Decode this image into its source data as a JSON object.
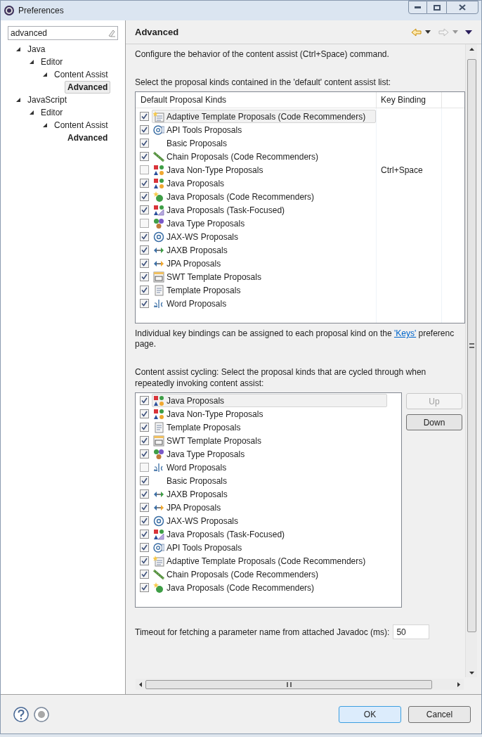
{
  "window": {
    "title": "Preferences"
  },
  "filter": {
    "value": "advanced"
  },
  "tree": [
    {
      "label": "Java",
      "expanded": true,
      "match": false,
      "selected": false,
      "children": [
        {
          "label": "Editor",
          "expanded": true,
          "match": false,
          "selected": false,
          "children": [
            {
              "label": "Content Assist",
              "expanded": true,
              "match": false,
              "selected": false,
              "children": [
                {
                  "label": "Advanced",
                  "match": true,
                  "selected": true
                }
              ]
            }
          ]
        }
      ]
    },
    {
      "label": "JavaScript",
      "expanded": true,
      "match": false,
      "selected": false,
      "children": [
        {
          "label": "Editor",
          "expanded": true,
          "match": false,
          "selected": false,
          "children": [
            {
              "label": "Content Assist",
              "expanded": true,
              "match": false,
              "selected": false,
              "children": [
                {
                  "label": "Advanced",
                  "match": true,
                  "selected": false
                }
              ]
            }
          ]
        }
      ]
    }
  ],
  "page": {
    "title": "Advanced",
    "description": "Configure the behavior of the content assist (Ctrl+Space) command.",
    "default_list_label": "Select the proposal kinds contained in the 'default' content assist list:",
    "default_table": {
      "columns": [
        "Default Proposal Kinds",
        "Key Binding"
      ],
      "rows": [
        {
          "kind": "template-rec",
          "label": "Adaptive Template Proposals (Code Recommenders)",
          "checked": true,
          "selected": true
        },
        {
          "kind": "api",
          "label": "API Tools Proposals",
          "checked": true,
          "selected": false
        },
        {
          "kind": "none",
          "label": "Basic Proposals",
          "checked": true,
          "selected": false
        },
        {
          "kind": "chain",
          "label": "Chain Proposals (Code Recommenders)",
          "checked": true,
          "selected": false
        },
        {
          "kind": "java",
          "label": "Java Non-Type Proposals",
          "checked": false,
          "selected": false,
          "key_binding": "Ctrl+Space"
        },
        {
          "kind": "java",
          "label": "Java Proposals",
          "checked": true,
          "selected": false
        },
        {
          "kind": "java-rec",
          "label": "Java Proposals (Code Recommenders)",
          "checked": true,
          "selected": false
        },
        {
          "kind": "java-task",
          "label": "Java Proposals (Task-Focused)",
          "checked": true,
          "selected": false
        },
        {
          "kind": "java-type",
          "label": "Java Type Proposals",
          "checked": false,
          "selected": false
        },
        {
          "kind": "at",
          "label": "JAX-WS Proposals",
          "checked": true,
          "selected": false
        },
        {
          "kind": "jaxb",
          "label": "JAXB Proposals",
          "checked": true,
          "selected": false
        },
        {
          "kind": "jpa",
          "label": "JPA Proposals",
          "checked": true,
          "selected": false
        },
        {
          "kind": "swt",
          "label": "SWT Template Proposals",
          "checked": true,
          "selected": false
        },
        {
          "kind": "template",
          "label": "Template Proposals",
          "checked": true,
          "selected": false
        },
        {
          "kind": "word",
          "label": "Word Proposals",
          "checked": true,
          "selected": false
        }
      ]
    },
    "key_bindings_note": {
      "before": "Individual key bindings can be assigned to each proposal kind on the",
      "link": "'Keys'",
      "after": "preferenc",
      "continuation": "page."
    },
    "cycling_label": "Content assist cycling: Select the proposal kinds that are cycled through when repeatedly invoking content assist:",
    "cycling_list": [
      {
        "kind": "java",
        "label": "Java Proposals",
        "checked": true,
        "selected": true
      },
      {
        "kind": "java",
        "label": "Java Non-Type Proposals",
        "checked": true,
        "selected": false
      },
      {
        "kind": "template",
        "label": "Template Proposals",
        "checked": true,
        "selected": false
      },
      {
        "kind": "swt",
        "label": "SWT Template Proposals",
        "checked": true,
        "selected": false
      },
      {
        "kind": "java-type",
        "label": "Java Type Proposals",
        "checked": true,
        "selected": false
      },
      {
        "kind": "word",
        "label": "Word Proposals",
        "checked": false,
        "selected": false
      },
      {
        "kind": "none",
        "label": "Basic Proposals",
        "checked": true,
        "selected": false
      },
      {
        "kind": "jaxb",
        "label": "JAXB Proposals",
        "checked": true,
        "selected": false
      },
      {
        "kind": "jpa",
        "label": "JPA Proposals",
        "checked": true,
        "selected": false
      },
      {
        "kind": "at",
        "label": "JAX-WS Proposals",
        "checked": true,
        "selected": false
      },
      {
        "kind": "java-task",
        "label": "Java Proposals (Task-Focused)",
        "checked": true,
        "selected": false
      },
      {
        "kind": "api",
        "label": "API Tools Proposals",
        "checked": true,
        "selected": false
      },
      {
        "kind": "template-rec",
        "label": "Adaptive Template Proposals (Code Recommenders)",
        "checked": true,
        "selected": false
      },
      {
        "kind": "chain",
        "label": "Chain Proposals (Code Recommenders)",
        "checked": true,
        "selected": false
      },
      {
        "kind": "java-rec",
        "label": "Java Proposals (Code Recommenders)",
        "checked": true,
        "selected": false
      }
    ],
    "order_buttons": [
      {
        "label": "Up",
        "disabled": true
      },
      {
        "label": "Down",
        "disabled": false
      }
    ],
    "timeout": {
      "label": "Timeout for fetching a parameter name from attached Javadoc (ms):",
      "value": "50"
    }
  },
  "buttons": [
    {
      "label": "OK",
      "default": true
    },
    {
      "label": "Cancel",
      "default": false
    }
  ]
}
